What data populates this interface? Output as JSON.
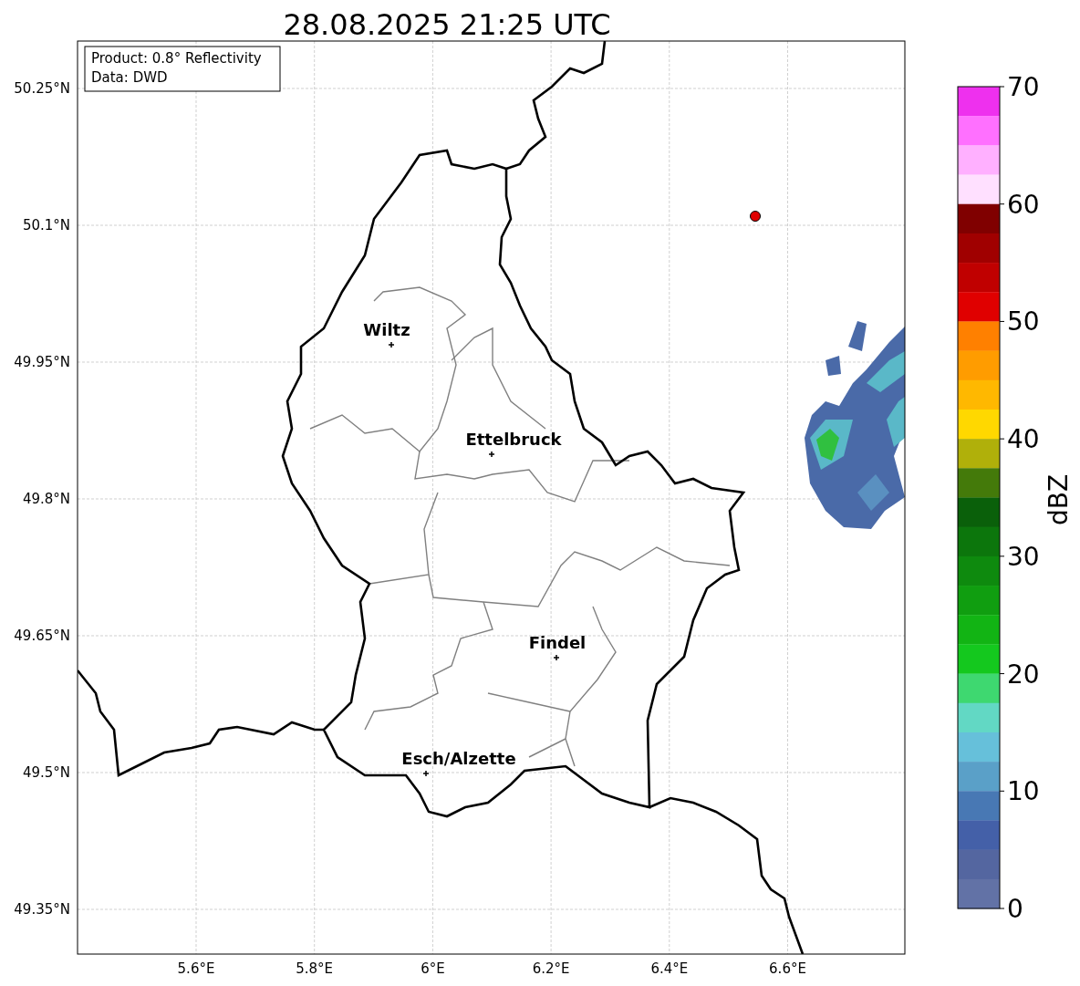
{
  "title": "28.08.2025 21:25 UTC",
  "info_box": {
    "lines": [
      "Product: 0.8° Reflectivity",
      "Data: DWD"
    ]
  },
  "map": {
    "lat_ticks": [
      "50.25°N",
      "50.1°N",
      "49.95°N",
      "49.8°N",
      "49.65°N",
      "49.5°N",
      "49.35°N"
    ],
    "lon_ticks": [
      "5.6°E",
      "5.8°E",
      "6°E",
      "6.2°E",
      "6.4°E",
      "6.6°E"
    ],
    "cities": [
      {
        "name": "Wiltz"
      },
      {
        "name": "Ettelbruck"
      },
      {
        "name": "Findel"
      },
      {
        "name": "Esch/Alzette"
      }
    ]
  },
  "colorbar": {
    "label": "dBZ",
    "ticks": [
      "70",
      "60",
      "50",
      "40",
      "30",
      "20",
      "10",
      "0"
    ],
    "bins": [
      {
        "color": "#ee30ee"
      },
      {
        "color": "#ff70ff"
      },
      {
        "color": "#ffb0ff"
      },
      {
        "color": "#ffe0ff"
      },
      {
        "color": "#800000"
      },
      {
        "color": "#a00000"
      },
      {
        "color": "#c00000"
      },
      {
        "color": "#e00000"
      },
      {
        "color": "#ff8000"
      },
      {
        "color": "#ff9c00"
      },
      {
        "color": "#ffb800"
      },
      {
        "color": "#ffd800"
      },
      {
        "color": "#b0b00a"
      },
      {
        "color": "#447a0a"
      },
      {
        "color": "#0a600a"
      },
      {
        "color": "#0c760c"
      },
      {
        "color": "#0e8a0e"
      },
      {
        "color": "#109e10"
      },
      {
        "color": "#12b414"
      },
      {
        "color": "#14c81e"
      },
      {
        "color": "#3ed870"
      },
      {
        "color": "#62d8c4"
      },
      {
        "color": "#66c0da"
      },
      {
        "color": "#5aa0c8"
      },
      {
        "color": "#4878b4"
      },
      {
        "color": "#4460a8"
      },
      {
        "color": "#5466a0"
      },
      {
        "color": "#6272a6"
      }
    ]
  }
}
